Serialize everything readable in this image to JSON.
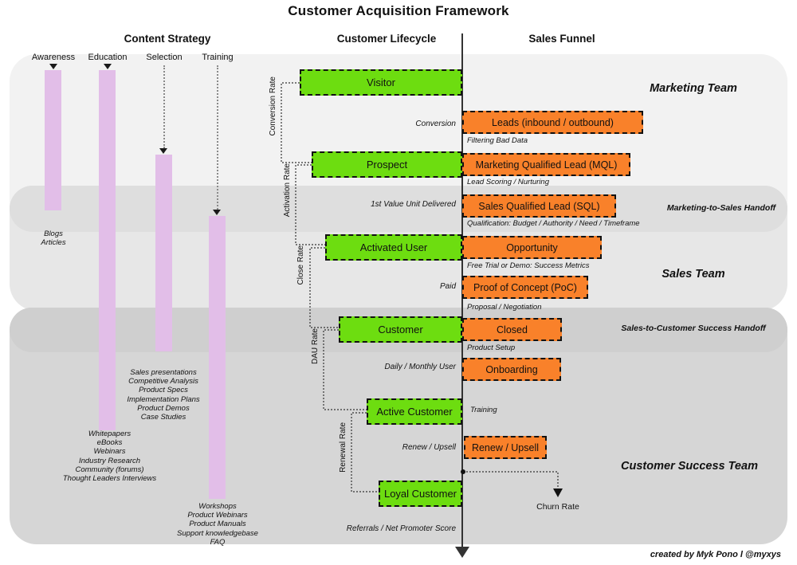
{
  "title": "Customer Acquisition Framework",
  "columns": [
    {
      "key": "content_strategy",
      "label": "Content Strategy"
    },
    {
      "key": "customer_lifecycle",
      "label": "Customer Lifecycle"
    },
    {
      "key": "sales_funnel",
      "label": "Sales Funnel"
    }
  ],
  "content_strategy": {
    "stages": [
      {
        "label": "Awareness",
        "items": "Blogs\nArticles"
      },
      {
        "label": "Education",
        "items": "Whitepapers\neBooks\nWebinars\nIndustry Research\nCommunity (forums)\nThought Leaders Interviews"
      },
      {
        "label": "Selection",
        "items": "Sales presentations\nCompetitive Analysis\nProduct Specs\nImplementation Plans\nProduct Demos\nCase Studies"
      },
      {
        "label": "Training",
        "items": "Workshops\nProduct Webinars\nProduct Manuals\nSupport knowledgebase\nFAQ"
      }
    ]
  },
  "customer_lifecycle": {
    "stages": [
      {
        "label": "Visitor"
      },
      {
        "label": "Prospect"
      },
      {
        "label": "Activated User"
      },
      {
        "label": "Customer"
      },
      {
        "label": "Active Customer"
      },
      {
        "label": "Loyal Customer"
      }
    ],
    "transitions": [
      {
        "label": "Conversion"
      },
      {
        "label": "1st Value Unit Delivered"
      },
      {
        "label": "Paid"
      },
      {
        "label": "Daily / Monthly User"
      },
      {
        "label": "Renew / Upsell"
      },
      {
        "label": "Referrals / Net Promoter Score"
      }
    ],
    "rates": [
      {
        "label": "Conversion Rate"
      },
      {
        "label": "Activation Rate"
      },
      {
        "label": "Close Rate"
      },
      {
        "label": "DAU Rate"
      },
      {
        "label": "Renewal Rate"
      }
    ]
  },
  "sales_funnel": {
    "stages": [
      {
        "label": "Leads (inbound / outbound)"
      },
      {
        "label": "Marketing Qualified Lead (MQL)"
      },
      {
        "label": "Sales Qualified Lead (SQL)"
      },
      {
        "label": "Opportunity"
      },
      {
        "label": "Proof of Concept (PoC)"
      },
      {
        "label": "Closed"
      },
      {
        "label": "Onboarding"
      },
      {
        "label": "Renew / Upsell"
      }
    ],
    "transitions": [
      {
        "label": "Filtering Bad Data"
      },
      {
        "label": "Lead Scoring / Nurturing"
      },
      {
        "label": "Qualification: Budget / Authority / Need / Timeframe"
      },
      {
        "label": "Free Trial or Demo: Success Metrics"
      },
      {
        "label": "Proposal / Negotiation"
      },
      {
        "label": "Product Setup"
      },
      {
        "label": "Training"
      }
    ]
  },
  "teams": [
    {
      "label": "Marketing Team"
    },
    {
      "label": "Sales Team"
    },
    {
      "label": "Customer Success Team"
    }
  ],
  "handoffs": [
    {
      "label": "Marketing-to-Sales Handoff"
    },
    {
      "label": "Sales-to-Customer Success Handoff"
    }
  ],
  "churn": {
    "label": "Churn Rate"
  },
  "credit": "created by Myk Pono l @myxys",
  "colors": {
    "green": "#6ddd10",
    "orange": "#f9812a",
    "purple": "#e2bee8",
    "band_light": "#f2f2f2",
    "band_mid": "#e6e6e6",
    "band_dark": "#d6d6d6",
    "axis": "#333333"
  }
}
